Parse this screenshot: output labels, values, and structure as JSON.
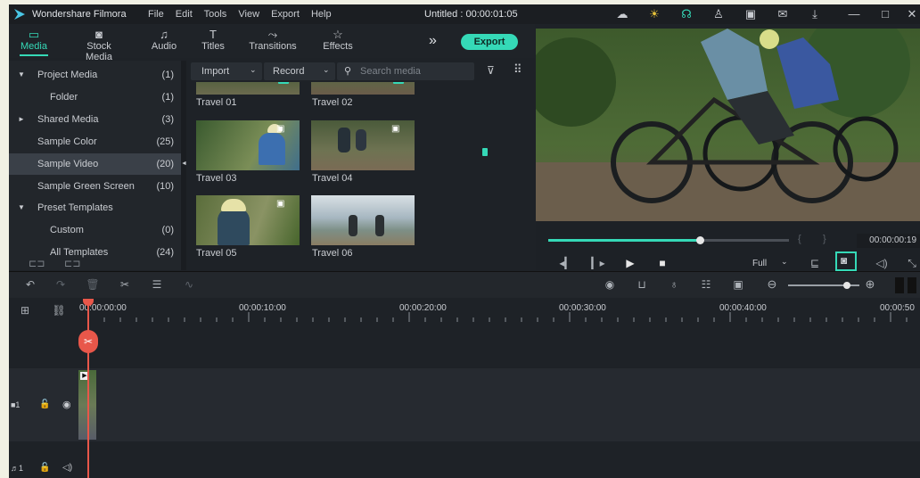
{
  "titlebar": {
    "app_name": "Wondershare Filmora",
    "menu": [
      "File",
      "Edit",
      "Tools",
      "View",
      "Export",
      "Help"
    ],
    "project_title": "Untitled : 00:00:01:05"
  },
  "tabs": [
    {
      "label": "Media",
      "icon": "folder-icon"
    },
    {
      "label": "Stock Media",
      "icon": "stock-icon"
    },
    {
      "label": "Audio",
      "icon": "music-icon"
    },
    {
      "label": "Titles",
      "icon": "text-icon"
    },
    {
      "label": "Transitions",
      "icon": "transition-icon"
    },
    {
      "label": "Effects",
      "icon": "effects-icon"
    }
  ],
  "more_glyph": "»",
  "export_label": "Export",
  "sidebar": [
    {
      "label": "Project Media",
      "count": "(1)",
      "arrow": "▼"
    },
    {
      "label": "Folder",
      "count": "(1)",
      "arrow": ""
    },
    {
      "label": "Shared Media",
      "count": "(3)",
      "arrow": "►"
    },
    {
      "label": "Sample Color",
      "count": "(25)",
      "arrow": ""
    },
    {
      "label": "Sample Video",
      "count": "(20)",
      "arrow": ""
    },
    {
      "label": "Sample Green Screen",
      "count": "(10)",
      "arrow": ""
    },
    {
      "label": "Preset Templates",
      "count": "",
      "arrow": "▼"
    },
    {
      "label": "Custom",
      "count": "(0)",
      "arrow": ""
    },
    {
      "label": "All Templates",
      "count": "(24)",
      "arrow": ""
    }
  ],
  "mediabar": {
    "import_label": "Import",
    "record_label": "Record",
    "search_placeholder": "Search media"
  },
  "media": [
    {
      "label": "Travel 01"
    },
    {
      "label": "Travel 02"
    },
    {
      "label": "Travel 03"
    },
    {
      "label": "Travel 04"
    },
    {
      "label": "Travel 05"
    },
    {
      "label": "Travel 06"
    }
  ],
  "preview": {
    "timecode": "00:00:00:19",
    "progress": 0.63,
    "bracket_in": "{",
    "bracket_out": "}",
    "quality": "Full"
  },
  "timeline": {
    "ticks": [
      "00:00:00:00",
      "00:00:10:00",
      "00:00:20:00",
      "00:00:30:00",
      "00:00:40:00",
      "00:00:50"
    ],
    "zoom": 0.55
  },
  "colors": {
    "accent": "#35d9b7",
    "playhead": "#e8574a"
  }
}
